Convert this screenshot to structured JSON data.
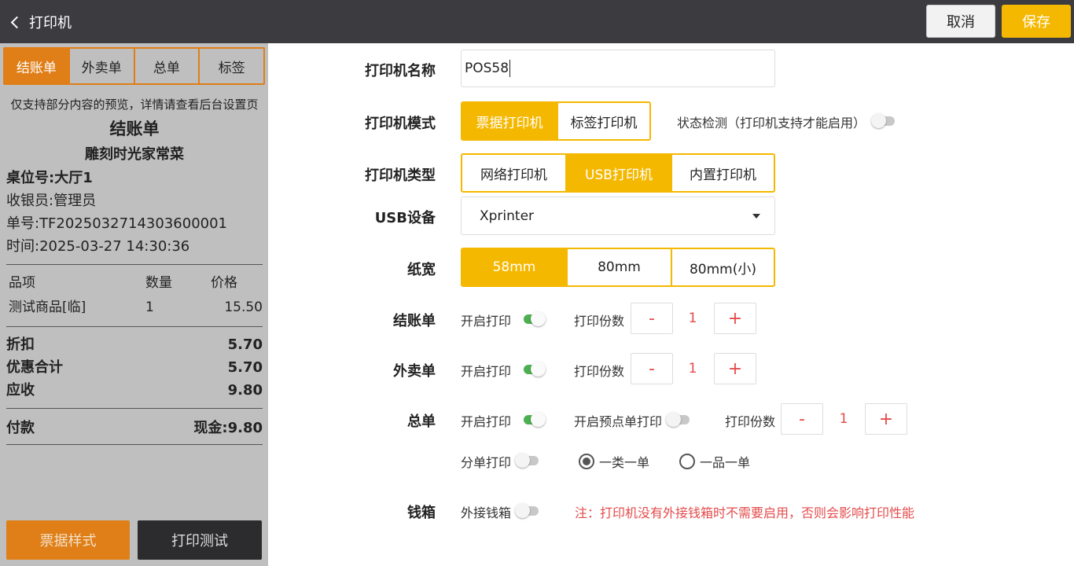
{
  "header": {
    "back_label": "打印机",
    "cancel_label": "取消",
    "save_label": "保存"
  },
  "left": {
    "tabs": [
      "结账单",
      "外卖单",
      "总单",
      "标签"
    ],
    "active_tab": 0,
    "receipt": {
      "note": "仅支持部分内容的预览，详情请查看后台设置页",
      "title": "结账单",
      "shop": "雕刻时光家常菜",
      "table": "桌位号:大厅1",
      "cashier": "收银员:管理员",
      "order_no": "单号:TF2025032714303600001",
      "time": "时间:2025-03-27 14:30:36",
      "columns": [
        "品项",
        "数量",
        "价格"
      ],
      "items": [
        {
          "name": "测试商品[临]",
          "qty": "1",
          "price": "15.50"
        }
      ],
      "summary": [
        {
          "label": "折扣",
          "value": "5.70"
        },
        {
          "label": "优惠合计",
          "value": "5.70"
        },
        {
          "label": "应收",
          "value": "9.80"
        }
      ],
      "payment": {
        "label": "付款",
        "value": "现金:9.80"
      }
    },
    "style_button": "票据样式",
    "test_button": "打印测试"
  },
  "form": {
    "name_label": "打印机名称",
    "name_value": "POS58",
    "mode_label": "打印机模式",
    "mode_options": [
      "票据打印机",
      "标签打印机"
    ],
    "status_check_label": "状态检测（打印机支持才能启用）",
    "type_label": "打印机类型",
    "type_options": [
      "网络打印机",
      "USB打印机",
      "内置打印机"
    ],
    "usb_label": "USB设备",
    "usb_value": "Xprinter",
    "width_label": "纸宽",
    "width_options": [
      "58mm",
      "80mm",
      "80mm(小)"
    ],
    "checkout_label": "结账单",
    "takeout_label": "外卖单",
    "total_label": "总单",
    "enable_print": "开启打印",
    "copies_label": "打印份数",
    "minus": "-",
    "plus": "+",
    "checkout_copies": "1",
    "takeout_copies": "1",
    "total_copies": "1",
    "preorder_print": "开启预点单打印",
    "split_print": "分单打印",
    "radio_one_class": "一类一单",
    "radio_one_item": "一品一单",
    "cashbox_label": "钱箱",
    "external_cashbox": "外接钱箱",
    "cashbox_warning": "注：打印机没有外接钱箱时不需要启用，否则会影响打印性能"
  },
  "colors": {
    "accent": "#f5b800",
    "left_accent": "#e07e17",
    "topbar": "#3b3b40",
    "toggle_on": "#4caf50",
    "warning": "#e54b4b"
  }
}
